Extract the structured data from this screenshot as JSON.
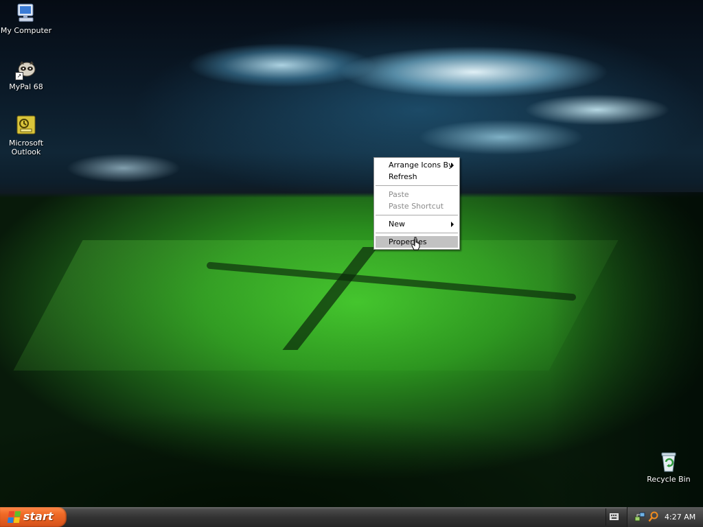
{
  "desktop": {
    "icons": [
      {
        "label": "My Computer",
        "icon": "my-computer-icon"
      },
      {
        "label": "MyPal 68",
        "icon": "mypal-icon"
      },
      {
        "label": "Microsoft\nOutlook",
        "icon": "outlook-icon"
      },
      {
        "label": "Recycle Bin",
        "icon": "recycle-bin-icon"
      }
    ]
  },
  "context_menu": {
    "items": {
      "arrange_icons_by": "Arrange Icons By",
      "refresh": "Refresh",
      "paste": "Paste",
      "paste_shortcut": "Paste Shortcut",
      "new": "New",
      "properties": "Properties"
    },
    "highlighted": "Properties",
    "disabled": [
      "Paste",
      "Paste Shortcut"
    ]
  },
  "taskbar": {
    "start_label": "start",
    "clock": "4:27 AM",
    "colors": {
      "start_button": "#e5601f",
      "bar": "#333333"
    }
  }
}
